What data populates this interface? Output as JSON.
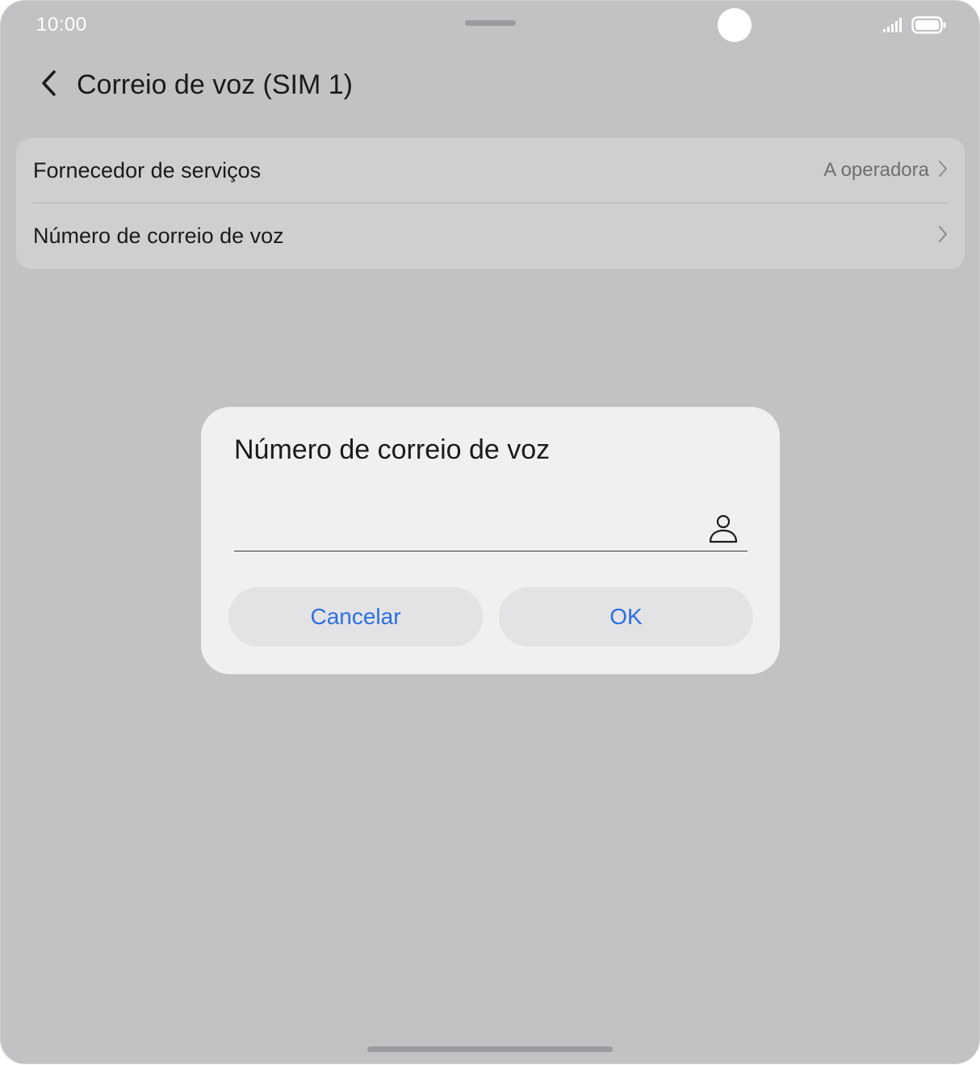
{
  "status_bar": {
    "time": "10:00",
    "icons": [
      "signal-icon",
      "battery-icon"
    ]
  },
  "header": {
    "back_icon": "chevron-left-icon",
    "title": "Correio de voz (SIM 1)"
  },
  "settings": {
    "items": [
      {
        "label": "Fornecedor de serviços",
        "value": "A operadora",
        "icon": "chevron-right-icon"
      },
      {
        "label": "Número de correio de voz",
        "value": "",
        "icon": "chevron-right-icon"
      }
    ]
  },
  "dialog": {
    "title": "Número de correio de voz",
    "input": {
      "value": "",
      "placeholder": "",
      "icon": "contact-person-icon"
    },
    "cancel_label": "Cancelar",
    "ok_label": "OK"
  },
  "colors": {
    "background": "#c2c2c5",
    "card": "#cfcfd1",
    "dialog": "#f0f0f0",
    "button": "#e3e3e5",
    "accent": "#2d6fe0",
    "text": "#1b1b1c",
    "secondary_text": "#6f6f72"
  }
}
